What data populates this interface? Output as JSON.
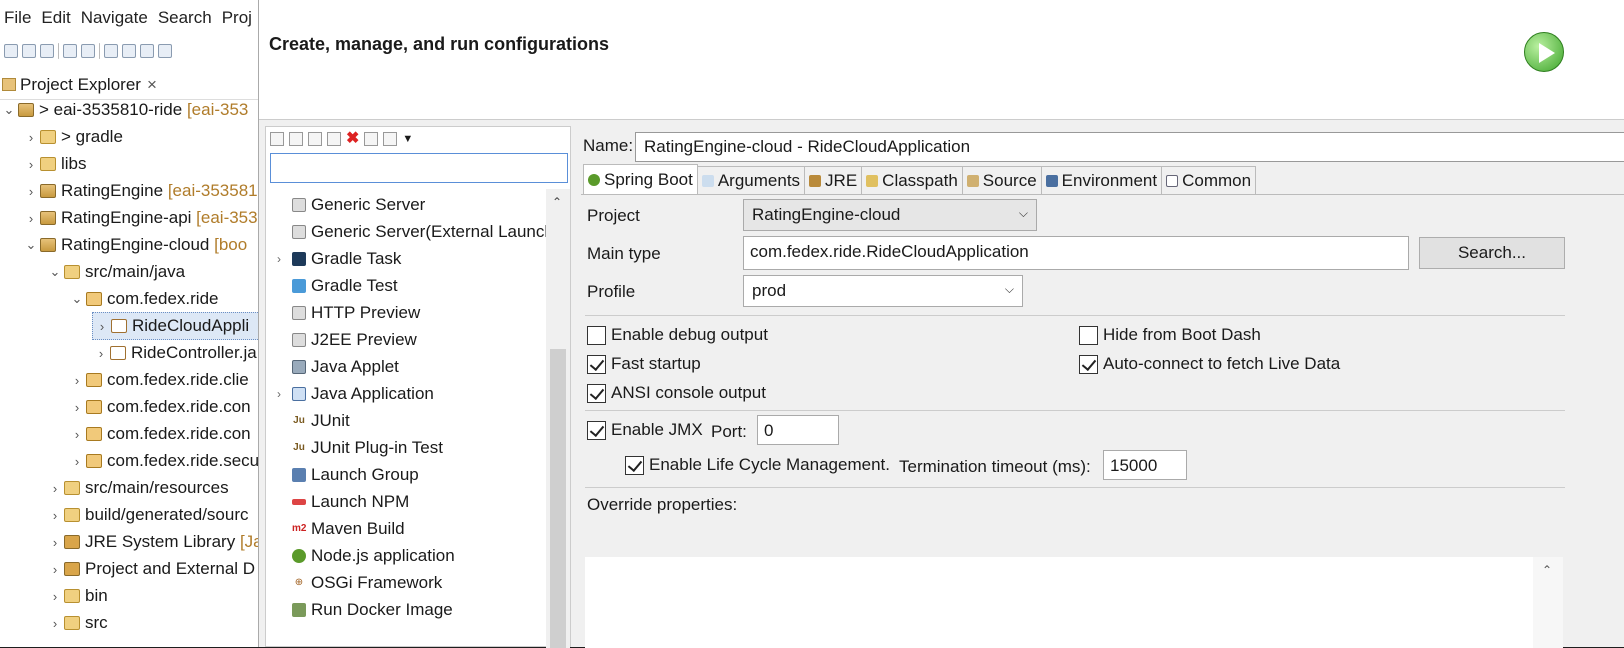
{
  "eclipse": {
    "menu": [
      "File",
      "Edit",
      "Navigate",
      "Search",
      "Proj"
    ],
    "explorer_tab": "Project Explorer",
    "explorer_close": "×",
    "tree": [
      {
        "label": "> eai-3535810-ride",
        "decor": "[eai-353"
      },
      {
        "label": "> gradle",
        "decor": ""
      },
      {
        "label": "libs",
        "decor": ""
      },
      {
        "label": "RatingEngine",
        "decor": "[eai-353581"
      },
      {
        "label": "RatingEngine-api",
        "decor": "[eai-353"
      },
      {
        "label": "RatingEngine-cloud",
        "decor": "[boo"
      },
      {
        "label": "src/main/java",
        "decor": ""
      },
      {
        "label": "com.fedex.ride",
        "decor": ""
      },
      {
        "label": "RideCloudAppli",
        "decor": ""
      },
      {
        "label": "RideController.ja",
        "decor": ""
      },
      {
        "label": "com.fedex.ride.clie",
        "decor": ""
      },
      {
        "label": "com.fedex.ride.con",
        "decor": ""
      },
      {
        "label": "com.fedex.ride.con",
        "decor": ""
      },
      {
        "label": "com.fedex.ride.secu",
        "decor": ""
      },
      {
        "label": "src/main/resources",
        "decor": ""
      },
      {
        "label": "build/generated/sourc",
        "decor": ""
      },
      {
        "label": "JRE System Library",
        "decor": "[Jav"
      },
      {
        "label": "Project and External D",
        "decor": ""
      },
      {
        "label": "bin",
        "decor": ""
      },
      {
        "label": "src",
        "decor": ""
      }
    ]
  },
  "dialog": {
    "title": "Create, manage, and run configurations",
    "filter_placeholder": "",
    "config_types": [
      "Generic Server",
      "Generic Server(External Launch",
      "Gradle Task",
      "Gradle Test",
      "HTTP Preview",
      "J2EE Preview",
      "Java Applet",
      "Java Application",
      "JUnit",
      "JUnit Plug-in Test",
      "Launch Group",
      "Launch NPM",
      "Maven Build",
      "Node.js application",
      "OSGi Framework",
      "Run Docker Image"
    ],
    "name_label": "Name:",
    "name_value": "RatingEngine-cloud - RideCloudApplication",
    "tabs": [
      "Spring Boot",
      "Arguments",
      "JRE",
      "Classpath",
      "Source",
      "Environment",
      "Common"
    ],
    "project_label": "Project",
    "project_value": "RatingEngine-cloud",
    "main_type_label": "Main type",
    "main_type_value": "com.fedex.ride.RideCloudApplication",
    "search_button": "Search...",
    "profile_label": "Profile",
    "profile_value": "prod",
    "options": {
      "enable_debug": {
        "label": "Enable debug output",
        "checked": false
      },
      "hide_from_boot_dash": {
        "label": "Hide from Boot Dash",
        "checked": false
      },
      "fast_startup": {
        "label": "Fast startup",
        "checked": true
      },
      "auto_connect": {
        "label": "Auto-connect to fetch Live Data",
        "checked": true
      },
      "ansi_console": {
        "label": "ANSI console output",
        "checked": true
      },
      "enable_jmx": {
        "label": "Enable JMX",
        "checked": true
      },
      "lifecycle": {
        "label": "Enable Life Cycle Management.",
        "checked": true
      }
    },
    "port_label": "Port:",
    "port_value": "0",
    "termination_label": "Termination timeout (ms):",
    "termination_value": "15000",
    "override_label": "Override properties:"
  },
  "colors": {
    "accent": "#5a8fd8",
    "run_green": "#3da42a"
  }
}
